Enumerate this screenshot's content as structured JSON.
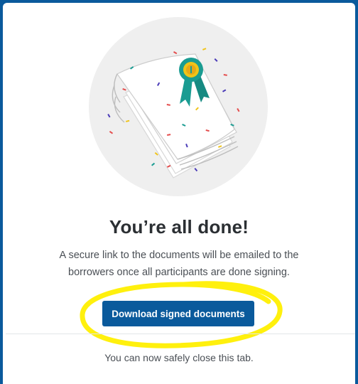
{
  "dialog": {
    "title": "You’re all done!",
    "description": "A secure link to the documents will be emailed to the borrowers once all participants are done signing.",
    "download_button_label": "Download signed documents",
    "footer_text": "You can now safely close this tab."
  },
  "colors": {
    "frame": "#0a5a9c",
    "button_background": "#0a5a9c",
    "highlight_marker": "#ffef00",
    "ribbon": "#1a9c92",
    "seal": "#f0c419"
  },
  "icons": {
    "illustration": "signed-documents-with-award-ribbon-and-confetti"
  }
}
